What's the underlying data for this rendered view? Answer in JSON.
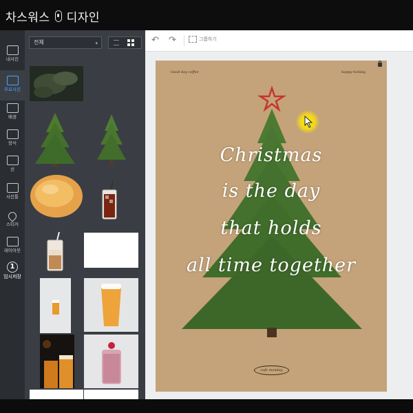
{
  "app": {
    "title_left": "차스워스",
    "title_right": "디자인"
  },
  "tools": [
    {
      "name": "photo",
      "label": "내사진"
    },
    {
      "name": "free-photo",
      "label": "무료사진"
    },
    {
      "name": "background",
      "label": "배경"
    },
    {
      "name": "decoration",
      "label": "장식"
    },
    {
      "name": "line",
      "label": "선"
    },
    {
      "name": "photo-frame",
      "label": "사진틀"
    },
    {
      "name": "sticker",
      "label": "스티커"
    },
    {
      "name": "layout",
      "label": "레이아웃"
    },
    {
      "name": "save",
      "label": "임시저장",
      "badge": "1"
    }
  ],
  "panel": {
    "filter_value": "전체"
  },
  "toolbar": {
    "group_label": "그룹하기"
  },
  "canvas": {
    "tag_left": "Good day coffee",
    "tag_right": "happy holiday",
    "poem_lines": [
      "Christmas",
      "is the day",
      "that holds",
      "all time together"
    ],
    "footer": "cafe monday"
  },
  "colors": {
    "accent": "#4da3ff",
    "page_bg": "#c4a37a",
    "tree_green": "#3f6b2a",
    "star_red": "#c8342a"
  }
}
